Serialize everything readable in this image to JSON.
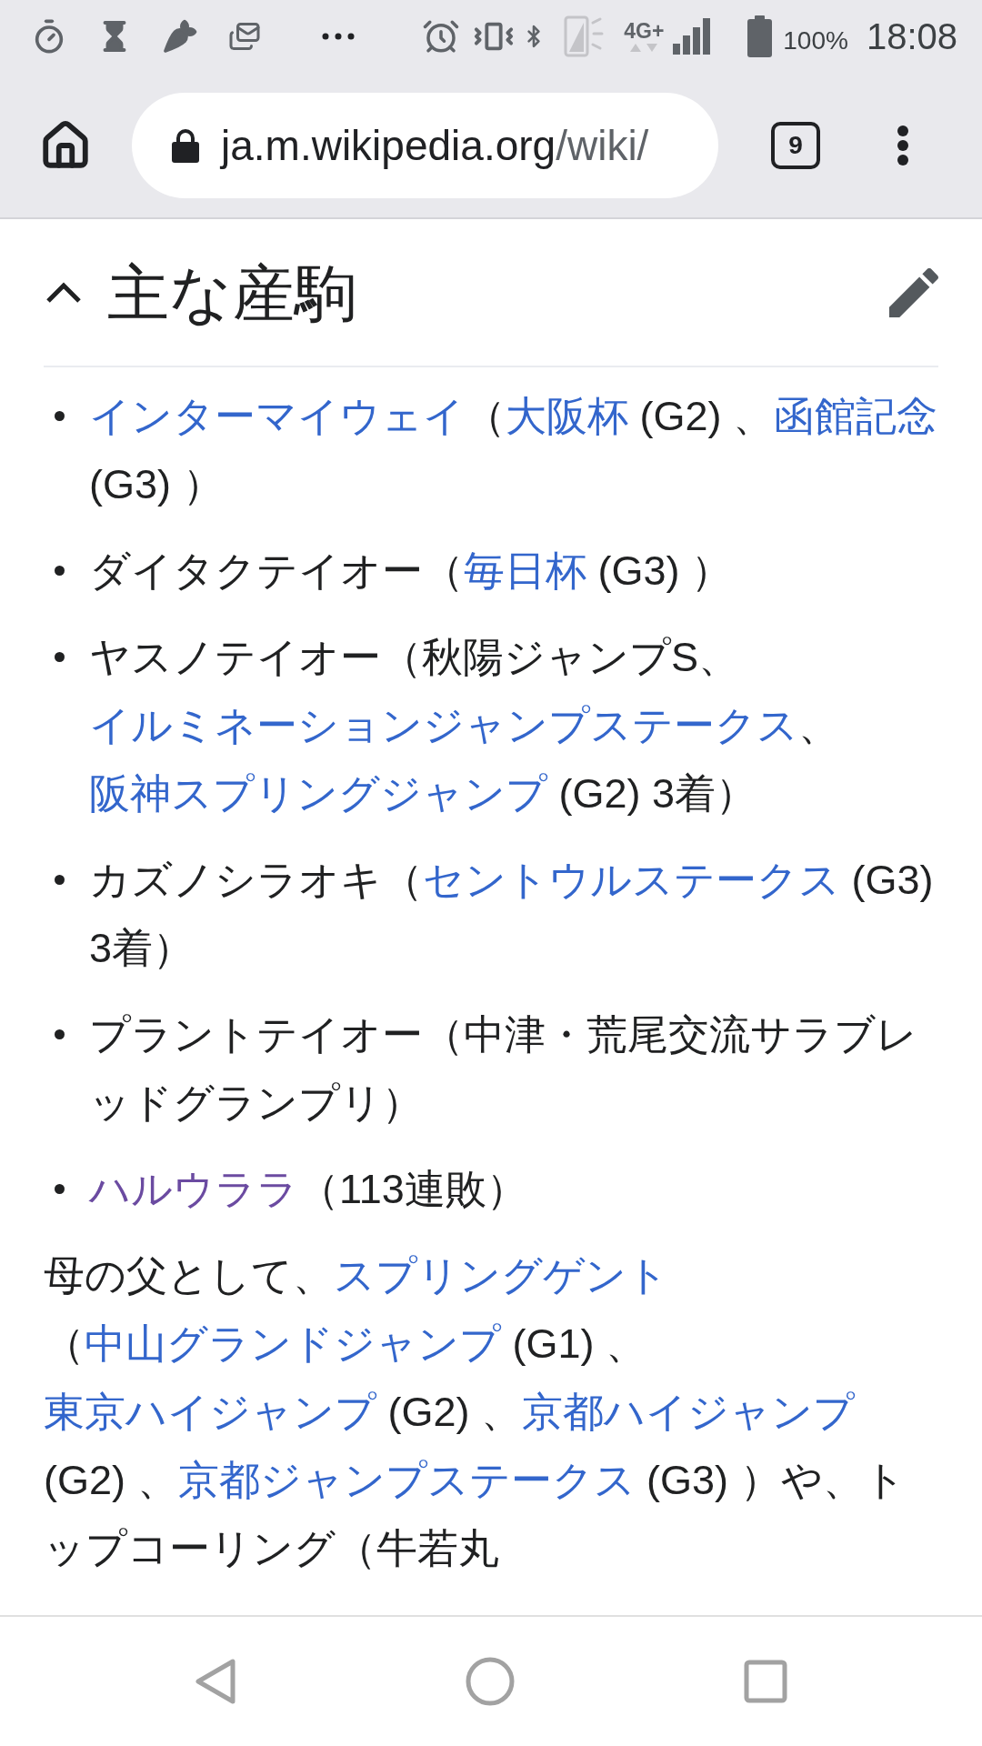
{
  "status_bar": {
    "network": "4G+",
    "battery": "100%",
    "time": "18:08"
  },
  "toolbar": {
    "url": {
      "domain": "ja.m.wikipedia.org",
      "path": "/wiki/"
    },
    "tab_count": "9"
  },
  "section": {
    "title": "主な産駒",
    "expanded": true
  },
  "list": [
    {
      "segments": [
        {
          "kind": "link",
          "text": "インターマイウェイ"
        },
        {
          "kind": "text",
          "text": "（"
        },
        {
          "kind": "link",
          "text": "大阪杯"
        },
        {
          "kind": "text",
          "text": " (G2) 、"
        },
        {
          "kind": "link",
          "text": "函館記念"
        },
        {
          "kind": "text",
          "text": " (G3) ）"
        }
      ]
    },
    {
      "segments": [
        {
          "kind": "text",
          "text": "ダイタクテイオー（"
        },
        {
          "kind": "link",
          "text": "毎日杯"
        },
        {
          "kind": "text",
          "text": " (G3) ）"
        }
      ]
    },
    {
      "segments": [
        {
          "kind": "text",
          "text": "ヤスノテイオー（秋陽ジャンプS、"
        },
        {
          "kind": "link",
          "text": "イルミネーションジャンプステークス"
        },
        {
          "kind": "text",
          "text": "、"
        },
        {
          "kind": "link",
          "text": "阪神スプリングジャンプ"
        },
        {
          "kind": "text",
          "text": " (G2) 3着）"
        }
      ]
    },
    {
      "segments": [
        {
          "kind": "text",
          "text": "カズノシラオキ（"
        },
        {
          "kind": "link",
          "text": "セントウルステークス"
        },
        {
          "kind": "text",
          "text": " (G3) 3着）"
        }
      ]
    },
    {
      "segments": [
        {
          "kind": "text",
          "text": "プラントテイオー（中津・荒尾交流サラブレッドグランプリ）"
        }
      ]
    },
    {
      "segments": [
        {
          "kind": "visited_link",
          "text": "ハルウララ"
        },
        {
          "kind": "text",
          "text": "（113連敗）"
        }
      ]
    }
  ],
  "paragraph": {
    "segments": [
      {
        "kind": "text",
        "text": "母の父として、"
      },
      {
        "kind": "link",
        "text": "スプリングゲント"
      },
      {
        "kind": "text",
        "text": "（"
      },
      {
        "kind": "link",
        "text": "中山グランドジャンプ"
      },
      {
        "kind": "text",
        "text": " (G1) 、"
      },
      {
        "kind": "link",
        "text": "東京ハイジャンプ"
      },
      {
        "kind": "text",
        "text": " (G2) 、"
      },
      {
        "kind": "link",
        "text": "京都ハイジャンプ"
      },
      {
        "kind": "text",
        "text": " (G2) 、"
      },
      {
        "kind": "link",
        "text": "京都ジャンプステークス"
      },
      {
        "kind": "text",
        "text": " (G3) ）や、トップコーリング（牛若丸"
      }
    ]
  }
}
